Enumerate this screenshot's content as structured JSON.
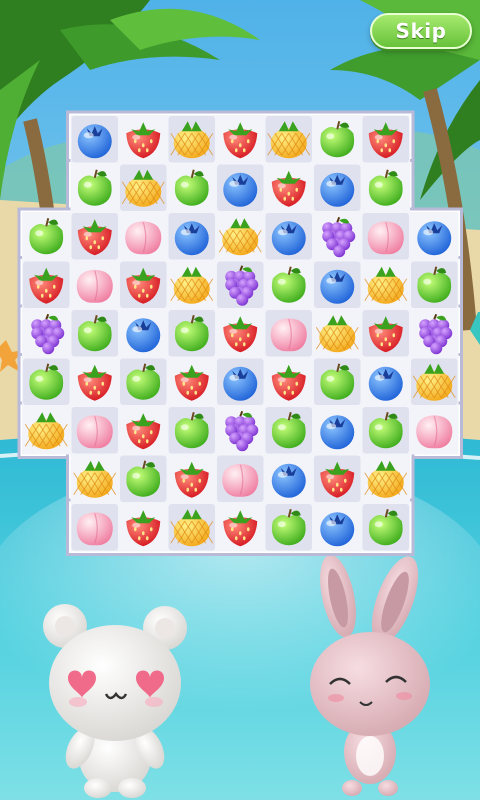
{
  "skip_button": {
    "label": "Skip"
  },
  "colors": {
    "sky_top": "#59b7e6",
    "sea": "#3fc7d8",
    "sand": "#e8d7a6",
    "board_frame": "#b9bad8",
    "tile_light": "#f3f4fa",
    "tile_dark": "#dfe2ee",
    "skip_green": "#79d14b"
  },
  "board": {
    "rows": [
      [
        "blueberry",
        "strawberry",
        "pineapple",
        "strawberry",
        "pineapple",
        "apple",
        "strawberry"
      ],
      [
        "apple",
        "pineapple",
        "apple",
        "blueberry",
        "strawberry",
        "blueberry",
        "apple"
      ],
      [
        "apple",
        "strawberry",
        "peach",
        "blueberry",
        "pineapple",
        "blueberry",
        "grapes",
        "peach",
        "blueberry"
      ],
      [
        "strawberry",
        "peach",
        "strawberry",
        "pineapple",
        "grapes",
        "apple",
        "blueberry",
        "pineapple",
        "apple"
      ],
      [
        "grapes",
        "apple",
        "blueberry",
        "apple",
        "strawberry",
        "peach",
        "pineapple",
        "strawberry",
        "grapes"
      ],
      [
        "apple",
        "strawberry",
        "apple",
        "strawberry",
        "blueberry",
        "strawberry",
        "apple",
        "blueberry",
        "pineapple"
      ],
      [
        "pineapple",
        "peach",
        "strawberry",
        "apple",
        "grapes",
        "apple",
        "blueberry",
        "apple",
        "peach"
      ],
      [
        "pineapple",
        "apple",
        "strawberry",
        "peach",
        "blueberry",
        "strawberry",
        "pineapple"
      ],
      [
        "peach",
        "strawberry",
        "pineapple",
        "strawberry",
        "apple",
        "blueberry",
        "apple"
      ]
    ]
  },
  "characters": [
    {
      "name": "white-bear",
      "icon": "bear-heart-eyes"
    },
    {
      "name": "pink-bunny",
      "icon": "bunny-smiling"
    }
  ]
}
